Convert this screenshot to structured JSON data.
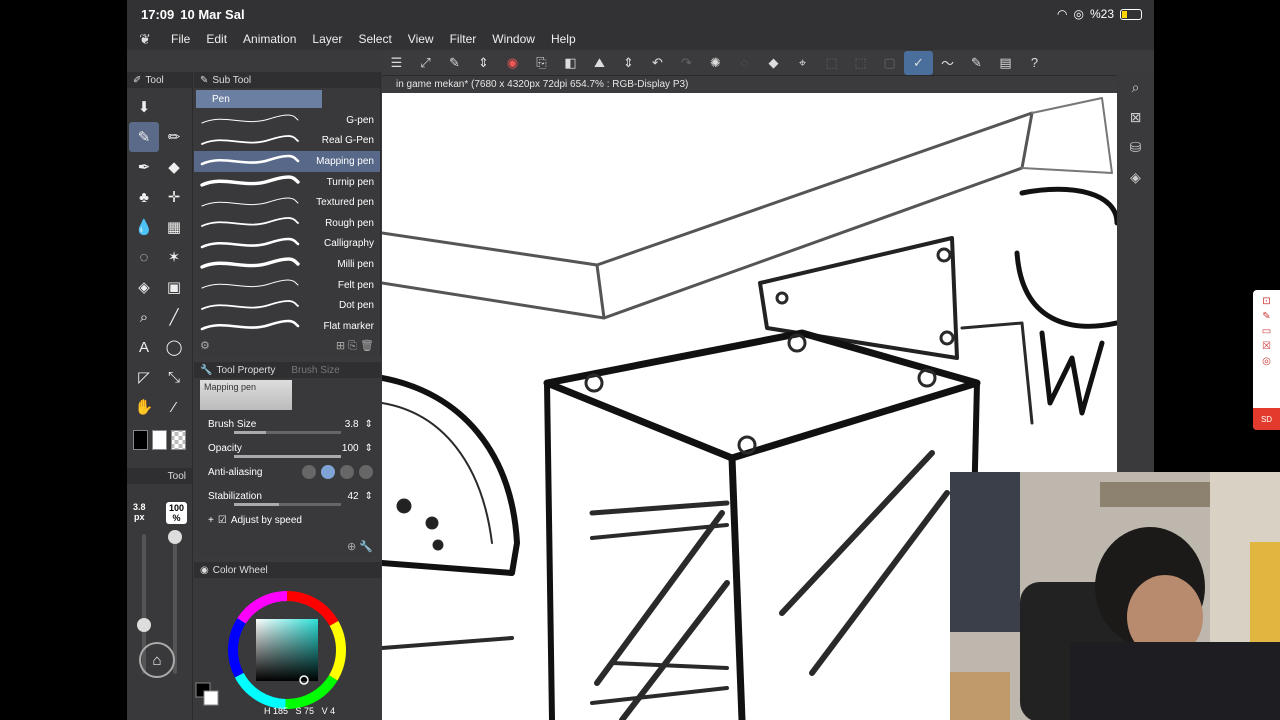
{
  "status": {
    "time": "17:09",
    "date": "10 Mar Sal",
    "battery": "%23"
  },
  "menu": [
    "File",
    "Edit",
    "Animation",
    "Layer",
    "Select",
    "View",
    "Filter",
    "Window",
    "Help"
  ],
  "panels": {
    "tool": "Tool",
    "subtool": "Sub Tool",
    "tool_property": "Tool Property",
    "brush_size_tab": "Brush Size",
    "color_wheel": "Color Wheel"
  },
  "subtool_group": "Pen",
  "brushes": [
    {
      "name": "G-pen"
    },
    {
      "name": "Real G-Pen"
    },
    {
      "name": "Mapping pen"
    },
    {
      "name": "Turnip pen"
    },
    {
      "name": "Textured pen"
    },
    {
      "name": "Rough pen"
    },
    {
      "name": "Calligraphy"
    },
    {
      "name": "Milli pen"
    },
    {
      "name": "Felt pen"
    },
    {
      "name": "Dot pen"
    },
    {
      "name": "Flat marker"
    }
  ],
  "selected_brush": "Mapping pen",
  "tool_property": {
    "title": "Mapping pen",
    "brush_size_label": "Brush Size",
    "brush_size": "3.8",
    "opacity_label": "Opacity",
    "opacity": "100",
    "antialias_label": "Anti-aliasing",
    "stabilization_label": "Stabilization",
    "stabilization": "42",
    "adjust_label": "Adjust by speed"
  },
  "left_readout": {
    "size": "3.8",
    "size_unit": "px",
    "opacity": "100",
    "opacity_unit": "%"
  },
  "color_readout": {
    "h": "185",
    "s": "75",
    "v": "4"
  },
  "colors": {
    "accent": "#5a6a88",
    "selection": "#576888",
    "fg": "#000000",
    "bg": "#ffffff"
  },
  "canvas_title": "in game mekan* (7680 x 4320px 72dpi 654.7% : RGB-Display P3)",
  "float_widget": {
    "rec_label": "SD"
  }
}
